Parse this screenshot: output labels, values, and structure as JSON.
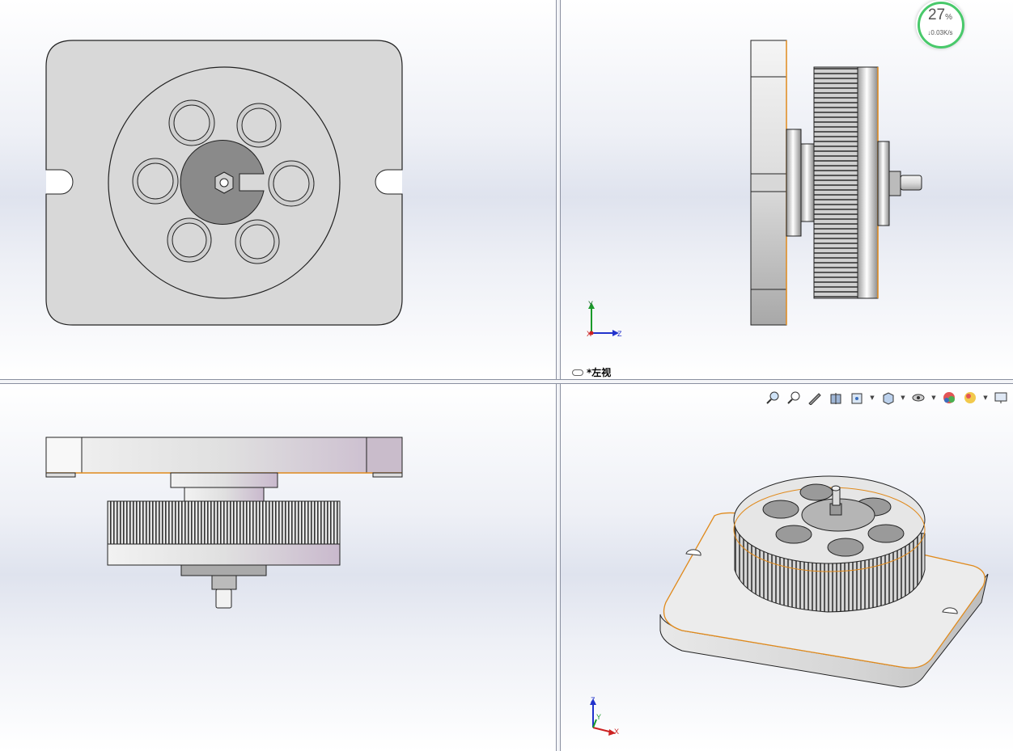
{
  "viewports": {
    "top_right": {
      "view_name": "*左视",
      "triad": {
        "up": "Y",
        "right": "Z",
        "origin": "X"
      }
    },
    "bottom_right": {
      "triad": {
        "up": "Z",
        "right": "X",
        "mid": "Y"
      }
    }
  },
  "network_widget": {
    "percent": "27",
    "percent_unit": "%",
    "speed": "0.03K/s"
  },
  "heads_up_toolbar": [
    {
      "name": "zoom-to-fit-icon"
    },
    {
      "name": "zoom-to-area-icon"
    },
    {
      "name": "previous-view-icon"
    },
    {
      "name": "section-view-icon"
    },
    {
      "name": "dynamic-annotation-icon"
    },
    {
      "name": "view-orientation-icon"
    },
    {
      "name": "display-style-icon"
    },
    {
      "name": "hide-show-items-icon"
    },
    {
      "name": "edit-appearance-icon"
    },
    {
      "name": "apply-scene-icon"
    },
    {
      "name": "view-settings-icon"
    }
  ],
  "colors": {
    "edge_highlight": "#e08a1c",
    "part_fill": "#d9d9d9",
    "outline": "#222222"
  }
}
